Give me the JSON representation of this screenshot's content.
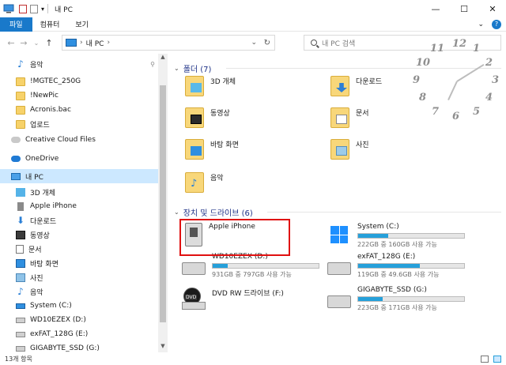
{
  "window": {
    "title": "내 PC",
    "controls": {
      "minimize": "—",
      "maximize": "☐",
      "close": "✕"
    }
  },
  "ribbon": {
    "tabs": [
      "파일",
      "컴퓨터",
      "보기"
    ],
    "expand_glyph": "⌄",
    "help_glyph": "?"
  },
  "address": {
    "back": "←",
    "forward": "→",
    "recent": "⌄",
    "up": "↑",
    "location": "내 PC",
    "separator": "›",
    "dropdown": "⌄",
    "refresh": "↻",
    "search_placeholder": "내 PC 검색"
  },
  "nav": {
    "items": [
      {
        "label": "음악",
        "icon": "music-icon",
        "pinned": true
      },
      {
        "label": "!MGTEC_250G",
        "icon": "folder-icon"
      },
      {
        "label": "!NewPic",
        "icon": "folder-icon"
      },
      {
        "label": "Acronis.bac",
        "icon": "folder-icon"
      },
      {
        "label": "업로드",
        "icon": "folder-icon"
      },
      {
        "label": "Creative Cloud Files",
        "icon": "creative-cloud-icon"
      },
      {
        "label": "OneDrive",
        "icon": "onedrive-icon"
      },
      {
        "label": "내 PC",
        "icon": "pc-icon",
        "selected": true
      },
      {
        "label": "3D 개체",
        "icon": "3d-objects-icon"
      },
      {
        "label": "Apple iPhone",
        "icon": "iphone-icon"
      },
      {
        "label": "다운로드",
        "icon": "download-icon"
      },
      {
        "label": "동영상",
        "icon": "video-icon"
      },
      {
        "label": "문서",
        "icon": "document-icon"
      },
      {
        "label": "바탕 화면",
        "icon": "desktop-icon"
      },
      {
        "label": "사진",
        "icon": "pictures-icon"
      },
      {
        "label": "음악",
        "icon": "music-icon"
      },
      {
        "label": "System (C:)",
        "icon": "system-drive-icon"
      },
      {
        "label": "WD10EZEX (D:)",
        "icon": "drive-icon"
      },
      {
        "label": "exFAT_128G (E:)",
        "icon": "drive-icon"
      },
      {
        "label": "GIGABYTE_SSD (G:)",
        "icon": "drive-icon"
      }
    ],
    "pin_glyph": "📌"
  },
  "content": {
    "folders_header": "폴더 (7)",
    "folders": [
      {
        "label": "3D 개체",
        "icon": "3d-objects-folder-icon"
      },
      {
        "label": "다운로드",
        "icon": "downloads-folder-icon"
      },
      {
        "label": "동영상",
        "icon": "videos-folder-icon"
      },
      {
        "label": "문서",
        "icon": "documents-folder-icon"
      },
      {
        "label": "바탕 화면",
        "icon": "desktop-folder-icon"
      },
      {
        "label": "사진",
        "icon": "pictures-folder-icon"
      },
      {
        "label": "음악",
        "icon": "music-folder-icon"
      }
    ],
    "drives_header": "장치 및 드라이브 (6)",
    "drives": [
      {
        "name": "Apple iPhone",
        "icon": "iphone-device-icon"
      },
      {
        "name": "System (C:)",
        "icon": "windows-drive-icon",
        "used_fraction": 0.28,
        "status": "222GB 중 160GB 사용 가능"
      },
      {
        "name": "WD10EZEX (D:)",
        "icon": "hard-drive-icon",
        "used_fraction": 0.14,
        "status": "931GB 중 797GB 사용 가능"
      },
      {
        "name": "exFAT_128G (E:)",
        "icon": "hard-drive-icon",
        "used_fraction": 0.58,
        "status": "119GB 중 49.6GB 사용 가능"
      },
      {
        "name": "DVD RW 드라이브 (F:)",
        "icon": "dvd-drive-icon",
        "dvd_label": "DVD"
      },
      {
        "name": "GIGABYTE_SSD (G:)",
        "icon": "hard-drive-icon",
        "used_fraction": 0.23,
        "status": "223GB 중 171GB 사용 가능"
      }
    ]
  },
  "clock": {
    "numbers": [
      "12",
      "1",
      "2",
      "3",
      "4",
      "5",
      "6",
      "7",
      "8",
      "9",
      "10",
      "11"
    ]
  },
  "status": {
    "item_count": "13개 항목"
  },
  "colors": {
    "accent": "#1979ca",
    "selection": "#cce8ff",
    "progress": "#26a0da",
    "highlight_box": "#e01010",
    "group_header": "#1e3287"
  }
}
